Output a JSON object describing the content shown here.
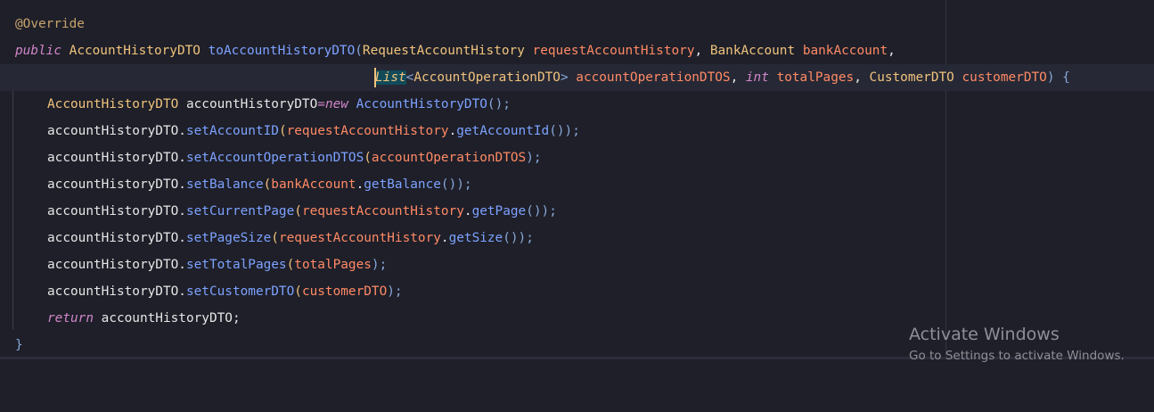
{
  "code": {
    "line1": {
      "annotation": "@Override"
    },
    "line2": {
      "kw_public": "public",
      "ret_type": "AccountHistoryDTO",
      "method": "toAccountHistoryDTO",
      "open": "(",
      "p1_type": "RequestAccountHistory",
      "p1_name": "requestAccountHistory",
      "comma1": ", ",
      "p2_type": "BankAccount",
      "p2_name": "bankAccount",
      "comma2": ","
    },
    "line3": {
      "list_type": "List",
      "lt": "<",
      "generic_type": "AccountOperationDTO",
      "gt": "> ",
      "p3_name": "accountOperationDTOS",
      "comma1": ", ",
      "kw_int": "int",
      "p4_name": "totalPages",
      "comma2": ", ",
      "p5_type": "CustomerDTO",
      "p5_name": "customerDTO",
      "close": ") {"
    },
    "line4": {
      "type": "AccountHistoryDTO",
      "var": "accountHistoryDTO",
      "eq": "=",
      "kw_new": "new",
      "ctor": "AccountHistoryDTO",
      "tail": "();"
    },
    "line5": {
      "obj": "accountHistoryDTO",
      "dot": ".",
      "method": "setAccountID",
      "open": "(",
      "arg_obj": "requestAccountHistory",
      "dot2": ".",
      "arg_method": "getAccountId",
      "tail": "());"
    },
    "line6": {
      "obj": "accountHistoryDTO",
      "dot": ".",
      "method": "setAccountOperationDTOS",
      "open": "(",
      "arg": "accountOperationDTOS",
      "tail": ");"
    },
    "line7": {
      "obj": "accountHistoryDTO",
      "dot": ".",
      "method": "setBalance",
      "open": "(",
      "arg_obj": "bankAccount",
      "dot2": ".",
      "arg_method": "getBalance",
      "tail": "());"
    },
    "line8": {
      "obj": "accountHistoryDTO",
      "dot": ".",
      "method": "setCurrentPage",
      "open": "(",
      "arg_obj": "requestAccountHistory",
      "dot2": ".",
      "arg_method": "getPage",
      "tail": "());"
    },
    "line9": {
      "obj": "accountHistoryDTO",
      "dot": ".",
      "method": "setPageSize",
      "open": "(",
      "arg_obj": "requestAccountHistory",
      "dot2": ".",
      "arg_method": "getSize",
      "tail": "());"
    },
    "line10": {
      "obj": "accountHistoryDTO",
      "dot": ".",
      "method": "setTotalPages",
      "open": "(",
      "arg": "totalPages",
      "tail": ");"
    },
    "line11": {
      "obj": "accountHistoryDTO",
      "dot": ".",
      "method": "setCustomerDTO",
      "open": "(",
      "arg": "customerDTO",
      "tail": ");"
    },
    "line12": {
      "kw_return": "return",
      "var": "accountHistoryDTO",
      "tail": ";"
    },
    "line13": {
      "brace": "}"
    }
  },
  "watermark": {
    "title": "Activate Windows",
    "subtitle": "Go to Settings to activate Windows."
  },
  "colors": {
    "background": "#1e1f29",
    "current_line": "#262835",
    "annotation": "#c7a46b",
    "keyword": "#d186c8",
    "type": "#f0c37c",
    "function": "#7da2ff",
    "parameter": "#ff8a65",
    "text": "#e6e6e6"
  }
}
